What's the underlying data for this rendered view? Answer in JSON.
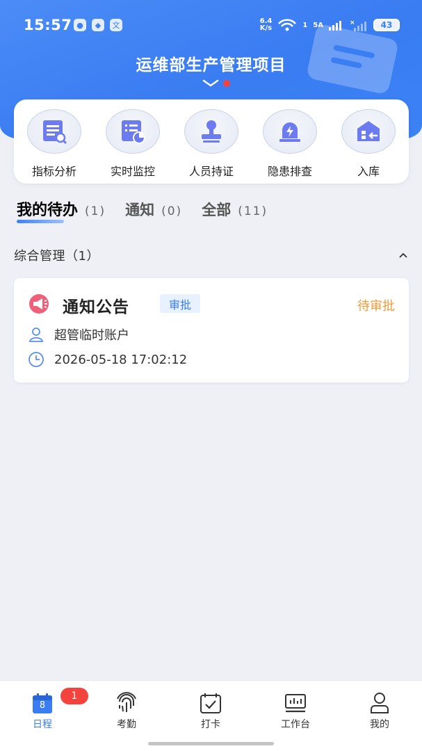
{
  "status_bar": {
    "time": "15:57",
    "net_speed_value": "6.4",
    "net_speed_unit": "K/s",
    "wifi_level": "1",
    "signal_type": "5A",
    "battery": "43"
  },
  "header": {
    "title": "运维部生产管理项目"
  },
  "quick_menu": [
    {
      "label": "指标分析",
      "icon": "chart-doc-icon"
    },
    {
      "label": "实时监控",
      "icon": "monitor-icon"
    },
    {
      "label": "人员持证",
      "icon": "stamp-icon"
    },
    {
      "label": "隐患排查",
      "icon": "alarm-icon"
    },
    {
      "label": "入库",
      "icon": "warehouse-in-icon"
    }
  ],
  "tabs": [
    {
      "name": "我的待办",
      "count": "(1)",
      "active": true
    },
    {
      "name": "通知",
      "count": "(0)",
      "active": false
    },
    {
      "name": "全部",
      "count": "(11)",
      "active": false
    }
  ],
  "section": {
    "title": "综合管理（1）"
  },
  "task": {
    "title": "通知公告",
    "tag": "审批",
    "status": "待审批",
    "user": "超管临时账户",
    "datetime": "2026-05-18 17:02:12"
  },
  "bottom_nav": [
    {
      "label": "日程",
      "icon": "calendar-icon",
      "active": true,
      "icon_text": "8"
    },
    {
      "label": "考勤",
      "icon": "fingerprint-icon",
      "active": false
    },
    {
      "label": "打卡",
      "icon": "calendar-check-icon",
      "active": false
    },
    {
      "label": "工作台",
      "icon": "workbench-icon",
      "active": false
    },
    {
      "label": "我的",
      "icon": "person-icon",
      "active": false
    }
  ],
  "badge": {
    "count": "1"
  },
  "colors": {
    "primary": "#3b82f6",
    "pending": "#f19a38",
    "badge": "#f4433c"
  }
}
